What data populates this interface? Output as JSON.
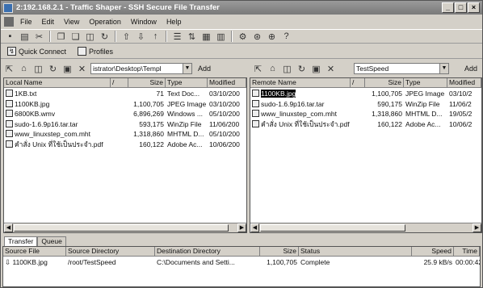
{
  "window": {
    "title": "2:192.168.2.1 - Traffic Shaper - SSH Secure File Transfer"
  },
  "menu": [
    "File",
    "Edit",
    "View",
    "Operation",
    "Window",
    "Help"
  ],
  "toolbar_icons": [
    "save-icon",
    "print-icon",
    "disconnect-icon",
    "copy-icon",
    "paste-icon",
    "new-folder-icon",
    "refresh-icon",
    "upload-icon",
    "download-icon",
    "up-icon",
    "list-view-icon",
    "sort-icon",
    "details-icon",
    "tile-icon",
    "settings-icon",
    "profile-icon",
    "connect-icon",
    "help-icon"
  ],
  "quickbar": {
    "quick_connect": "Quick Connect",
    "profiles": "Profiles"
  },
  "local": {
    "path": "istrator\\Desktop\\Templ",
    "add_label": "Add",
    "columns": [
      "Local Name",
      "/",
      "Size",
      "Type",
      "Modified"
    ],
    "files": [
      {
        "name": "1KB.txt",
        "size": "71",
        "type": "Text Doc...",
        "modified": "03/10/200"
      },
      {
        "name": "1100KB.jpg",
        "size": "1,100,705",
        "type": "JPEG Image",
        "modified": "03/10/200"
      },
      {
        "name": "6800KB.wmv",
        "size": "6,896,269",
        "type": "Windows ...",
        "modified": "05/10/200"
      },
      {
        "name": "sudo-1.6.9p16.tar.tar",
        "size": "593,175",
        "type": "WinZip File",
        "modified": "11/06/200"
      },
      {
        "name": "www_linuxstep_com.mht",
        "size": "1,318,860",
        "type": "MHTML D...",
        "modified": "05/10/200"
      },
      {
        "name": "คำสั่ง Unix ที่ใช้เป็นประจำ.pdf",
        "size": "160,122",
        "type": "Adobe Ac...",
        "modified": "10/06/200"
      }
    ]
  },
  "remote": {
    "path": "TestSpeed",
    "add_label": "Add",
    "columns": [
      "Remote Name",
      "/",
      "Size",
      "Type",
      "Modified"
    ],
    "files": [
      {
        "name": "1100KB.jpg",
        "size": "1,100,705",
        "type": "JPEG Image",
        "modified": "03/10/2",
        "selected": true
      },
      {
        "name": "sudo-1.6.9p16.tar.tar",
        "size": "590,175",
        "type": "WinZip File",
        "modified": "11/06/2"
      },
      {
        "name": "www_linuxstep_com.mht",
        "size": "1,318,860",
        "type": "MHTML D...",
        "modified": "19/05/2"
      },
      {
        "name": "คำสั่ง Unix ที่ใช้เป็นประจำ.pdf",
        "size": "160,122",
        "type": "Adobe Ac...",
        "modified": "10/06/2"
      }
    ]
  },
  "tabs": [
    "Transfer",
    "Queue"
  ],
  "transfer": {
    "columns": [
      "Source File",
      "Source Directory",
      "Destination Directory",
      "Size",
      "Status",
      "Speed",
      "Time"
    ],
    "rows": [
      {
        "source_file": "1100KB.jpg",
        "source_dir": "/root/TestSpeed",
        "dest_dir": "C:\\Documents and Setti...",
        "size": "1,100,705",
        "status": "Complete",
        "speed": "25.9 kB/s",
        "time": "00:00:42"
      }
    ]
  }
}
